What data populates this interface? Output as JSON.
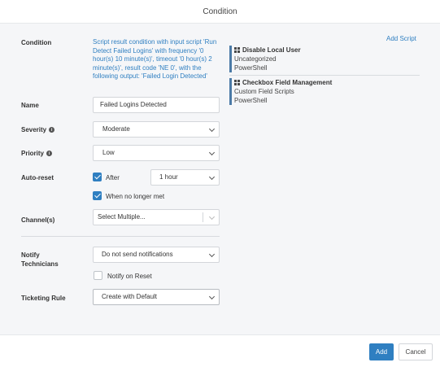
{
  "dialog": {
    "title": "Condition"
  },
  "condition": {
    "label": "Condition",
    "description": "Script result condition with input script 'Run Detect Failed Logins' with frequency '0 hour(s) 10 minute(s)', timeout '0 hour(s) 2 minute(s)', result code 'NE 0', with the following output: 'Failed Login Detected'"
  },
  "scripts": {
    "add_label": "Add Script",
    "items": [
      {
        "title": "Disable Local User",
        "category": "Uncategorized",
        "language": "PowerShell",
        "icon": "windows-icon"
      },
      {
        "title": "Checkbox Field Management",
        "category": "Custom Field Scripts",
        "language": "PowerShell",
        "icon": "windows-icon"
      }
    ]
  },
  "form": {
    "name": {
      "label": "Name",
      "value": "Failed Logins Detected"
    },
    "severity": {
      "label": "Severity",
      "value": "Moderate",
      "icon": "info-icon"
    },
    "priority": {
      "label": "Priority",
      "value": "Low",
      "icon": "info-icon"
    },
    "auto_reset": {
      "label": "Auto-reset",
      "after_label": "After",
      "after_checked": true,
      "after_value": "1 hour",
      "no_longer_met_label": "When no longer met",
      "no_longer_met_checked": true
    },
    "channels": {
      "label": "Channel(s)",
      "placeholder": "Select Multiple..."
    },
    "notify_technicians": {
      "label_line1": "Notify",
      "label_line2": "Technicians",
      "value": "Do not send notifications",
      "notify_on_reset_label": "Notify on Reset",
      "notify_on_reset_checked": false
    },
    "ticketing_rule": {
      "label": "Ticketing Rule",
      "value": "Create with Default"
    }
  },
  "footer": {
    "add_label": "Add",
    "cancel_label": "Cancel"
  },
  "colors": {
    "accent": "#2f7fc1",
    "script_bar": "#4b7aa6",
    "body_bg": "#f5f6f8"
  }
}
